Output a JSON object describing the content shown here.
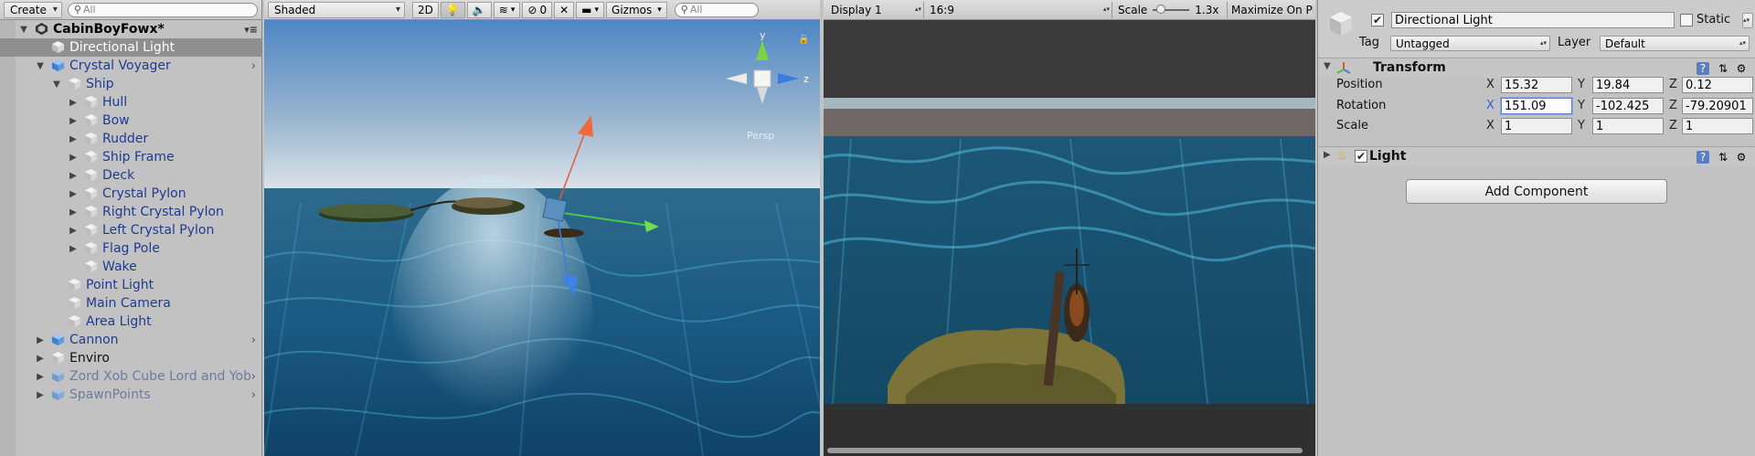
{
  "hierarchy": {
    "create_label": "Create",
    "search_placeholder": "All",
    "scene_name": "CabinBoyFowx*",
    "items": [
      {
        "label": "Directional Light"
      },
      {
        "label": "Crystal Voyager"
      },
      {
        "label": "Ship"
      },
      {
        "label": "Hull"
      },
      {
        "label": "Bow"
      },
      {
        "label": "Rudder"
      },
      {
        "label": "Ship Frame"
      },
      {
        "label": "Deck"
      },
      {
        "label": "Crystal Pylon"
      },
      {
        "label": "Right Crystal Pylon"
      },
      {
        "label": "Left Crystal Pylon"
      },
      {
        "label": "Flag Pole"
      },
      {
        "label": "Wake"
      },
      {
        "label": "Point Light"
      },
      {
        "label": "Main Camera"
      },
      {
        "label": "Area Light"
      },
      {
        "label": "Cannon"
      },
      {
        "label": "Enviro"
      },
      {
        "label": "Zord Xob Cube Lord and Yob"
      },
      {
        "label": "SpawnPoints"
      }
    ]
  },
  "scene": {
    "shading_mode": "Shaded",
    "mode_2d": "2D",
    "hidden_count": "0",
    "gizmos_label": "Gizmos",
    "search_placeholder": "All",
    "gizmo_y": "y",
    "gizmo_z": "z",
    "persp_label": "Persp"
  },
  "game": {
    "display": "Display 1",
    "aspect": "16:9",
    "scale_label": "Scale",
    "scale_value": "1.3x",
    "maximize_label": "Maximize On Pl"
  },
  "inspector": {
    "object_name": "Directional Light",
    "static_label": "Static",
    "tag_label": "Tag",
    "tag_value": "Untagged",
    "layer_label": "Layer",
    "layer_value": "Default",
    "transform_title": "Transform",
    "position_label": "Position",
    "rotation_label": "Rotation",
    "scale_label": "Scale",
    "axis_x": "X",
    "axis_y": "Y",
    "axis_z": "Z",
    "position": {
      "x": "15.32",
      "y": "19.84",
      "z": "0.12"
    },
    "rotation": {
      "x": "151.09",
      "y": "-102.425",
      "z": "-79.20901"
    },
    "scale": {
      "x": "1",
      "y": "1",
      "z": "1"
    },
    "light_title": "Light",
    "add_component_label": "Add Component"
  }
}
